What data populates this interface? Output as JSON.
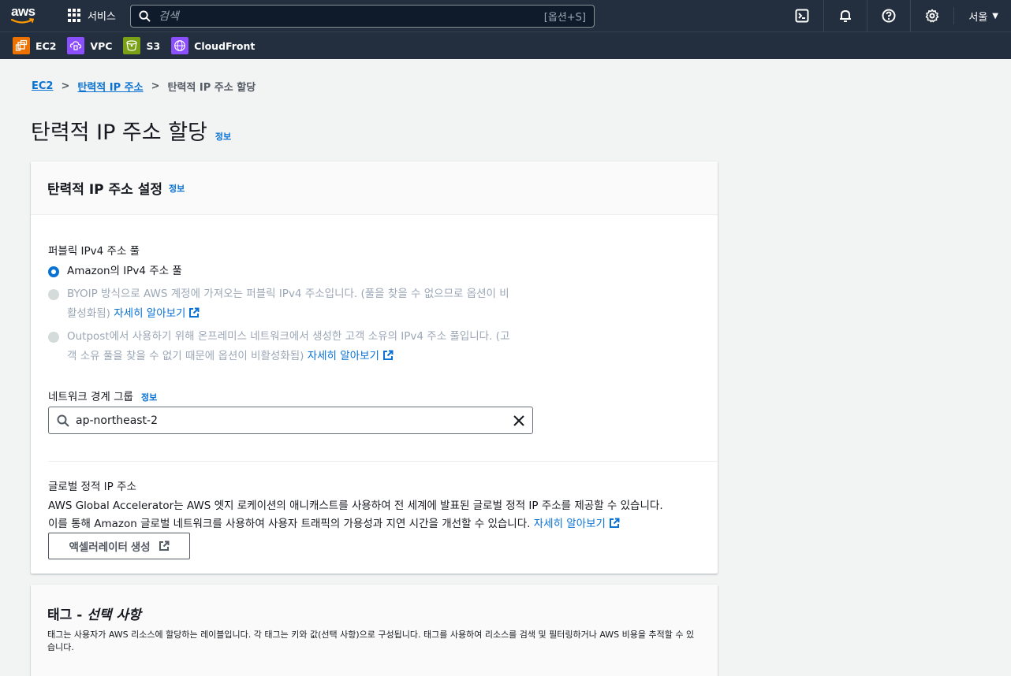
{
  "topbar": {
    "logo_text": "aws",
    "services_label": "서비스",
    "search_placeholder": "검색",
    "search_shortcut": "[옵션+S]",
    "region_label": "서울",
    "icons": [
      "cloudshell-icon",
      "bell-icon",
      "help-icon",
      "gear-icon"
    ]
  },
  "favorites": [
    {
      "label": "EC2",
      "color": "#ed7100",
      "icon": "ec2-icon"
    },
    {
      "label": "VPC",
      "color": "#8c4fff",
      "icon": "vpc-icon"
    },
    {
      "label": "S3",
      "color": "#7aa116",
      "icon": "s3-icon"
    },
    {
      "label": "CloudFront",
      "color": "#8c4fff",
      "icon": "cloudfront-icon"
    }
  ],
  "breadcrumb": {
    "items": [
      "EC2",
      "탄력적 IP 주소",
      "탄력적 IP 주소 할당"
    ]
  },
  "page": {
    "title": "탄력적 IP 주소 할당",
    "info": "정보"
  },
  "settings": {
    "title": "탄력적 IP 주소 설정",
    "info": "정보",
    "pool_label": "퍼블릭 IPv4 주소 풀",
    "options": [
      {
        "label": "Amazon의 IPv4 주소 풀",
        "selected": true,
        "disabled": false
      },
      {
        "label_line1": "BYOIP 방식으로 AWS 계정에 가져오는 퍼블릭 IPv4 주소입니다. (풀을 찾을 수 없으므로 옵션이 비",
        "label_line2": "활성화됨)",
        "link": "자세히 알아보기",
        "selected": false,
        "disabled": true
      },
      {
        "label_line1": "Outpost에서 사용하기 위해 온프레미스 네트워크에서 생성한 고객 소유의 IPv4 주소 풀입니다. (고",
        "label_line2": "객 소유 풀을 찾을 수 없기 때문에 옵션이 비활성화됨)",
        "link": "자세히 알아보기",
        "selected": false,
        "disabled": true
      }
    ],
    "nbg_label": "네트워크 경계 그룹",
    "nbg_info": "정보",
    "nbg_value": "ap-northeast-2",
    "global_label": "글로벌 정적 IP 주소",
    "global_desc_line1": "AWS Global Accelerator는 AWS 엣지 로케이션의 애니캐스트를 사용하여 전 세계에 발표된 글로벌 정적 IP 주소를 제공할 수 있습니다.",
    "global_desc_line2": "이를 통해 Amazon 글로벌 네트워크를 사용하여 사용자 트래픽의 가용성과 지연 시간을 개선할 수 있습니다.",
    "global_link": "자세히 알아보기",
    "accelerator_button": "액셀러레이터 생성"
  },
  "tags": {
    "title_main": "태그 - ",
    "title_em": "선택 사항",
    "description": "태그는 사용자가 AWS 리소스에 할당하는 레이블입니다. 각 태그는 키와 값(선택 사항)으로 구성됩니다. 태그를 사용하여 리소스를 검색 및 필터링하거나 AWS 비용을 추적할 수 있습니다."
  },
  "colors": {
    "nav_bg": "#232f3e",
    "link": "#0972d3",
    "page_bg": "#f2f3f3"
  }
}
